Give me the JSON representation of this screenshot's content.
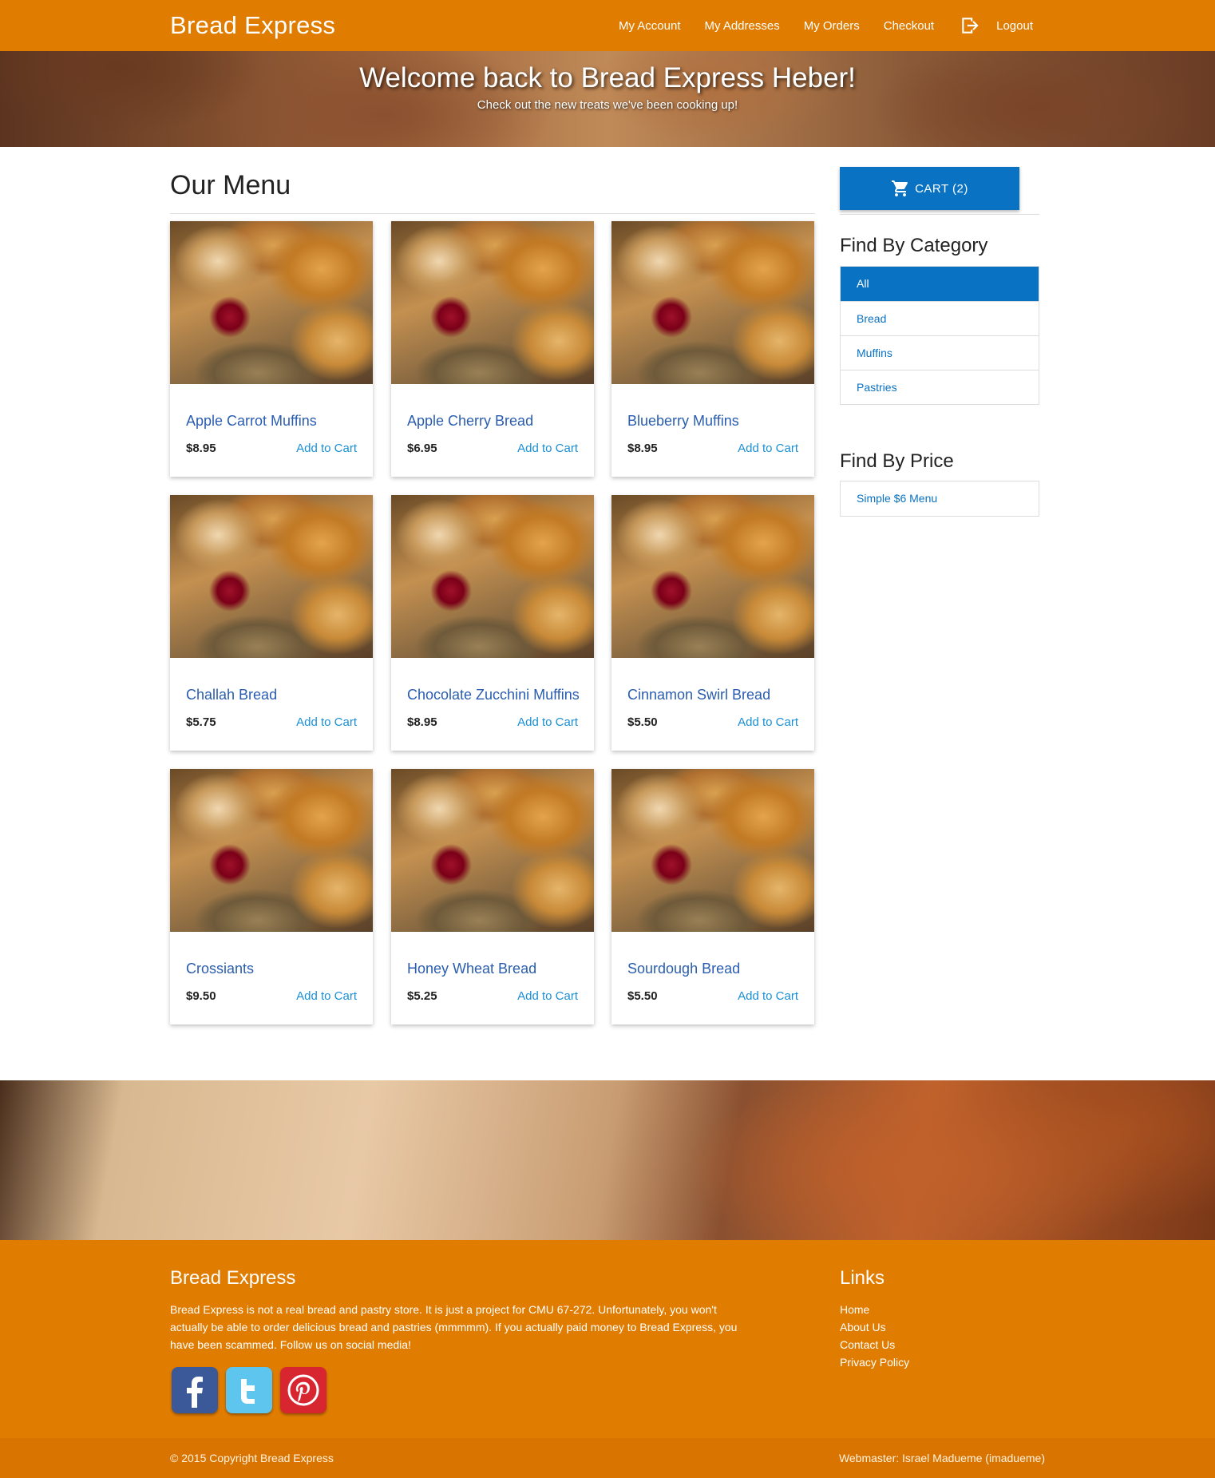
{
  "nav": {
    "brand": "Bread Express",
    "links": [
      "My Account",
      "My Addresses",
      "My Orders",
      "Checkout"
    ],
    "logout": "Logout"
  },
  "hero": {
    "title": "Welcome back to Bread Express Heber!",
    "subtitle": "Check out the new treats we've been cooking up!"
  },
  "menu": {
    "title": "Our Menu",
    "add_label": "Add to Cart",
    "items": [
      {
        "name": "Apple Carrot Muffins",
        "price": "$8.95"
      },
      {
        "name": "Apple Cherry Bread",
        "price": "$6.95"
      },
      {
        "name": "Blueberry Muffins",
        "price": "$8.95"
      },
      {
        "name": "Challah Bread",
        "price": "$5.75"
      },
      {
        "name": "Chocolate Zucchini Muffins",
        "price": "$8.95"
      },
      {
        "name": "Cinnamon Swirl Bread",
        "price": "$5.50"
      },
      {
        "name": "Crossiants",
        "price": "$9.50"
      },
      {
        "name": "Honey Wheat Bread",
        "price": "$5.25"
      },
      {
        "name": "Sourdough Bread",
        "price": "$5.50"
      }
    ]
  },
  "sidebar": {
    "cart_label": "CART (2)",
    "category_title": "Find By Category",
    "categories": [
      "All",
      "Bread",
      "Muffins",
      "Pastries"
    ],
    "price_title": "Find By Price",
    "price_options": [
      "Simple $6 Menu"
    ]
  },
  "footer": {
    "title": "Bread Express",
    "text": "Bread Express is not a real bread and pastry store. It is just a project for CMU 67-272. Unfortunately, you won't actually be able to order delicious bread and pastries (mmmmm). If you actually paid money to Bread Express, you have been scammed. Follow us on social media!",
    "links_title": "Links",
    "links": [
      "Home",
      "About Us",
      "Contact Us",
      "Privacy Policy"
    ],
    "copyright": "© 2015 Copyright Bread Express",
    "webmaster": "Webmaster: Israel Madueme (imadueme)"
  },
  "colors": {
    "brand_orange": "#e07c00",
    "primary_blue": "#0a72c2",
    "link_blue": "#1a8fd6"
  },
  "icons": [
    "logout-icon",
    "cart-icon",
    "facebook-icon",
    "twitter-icon",
    "pinterest-icon"
  ]
}
